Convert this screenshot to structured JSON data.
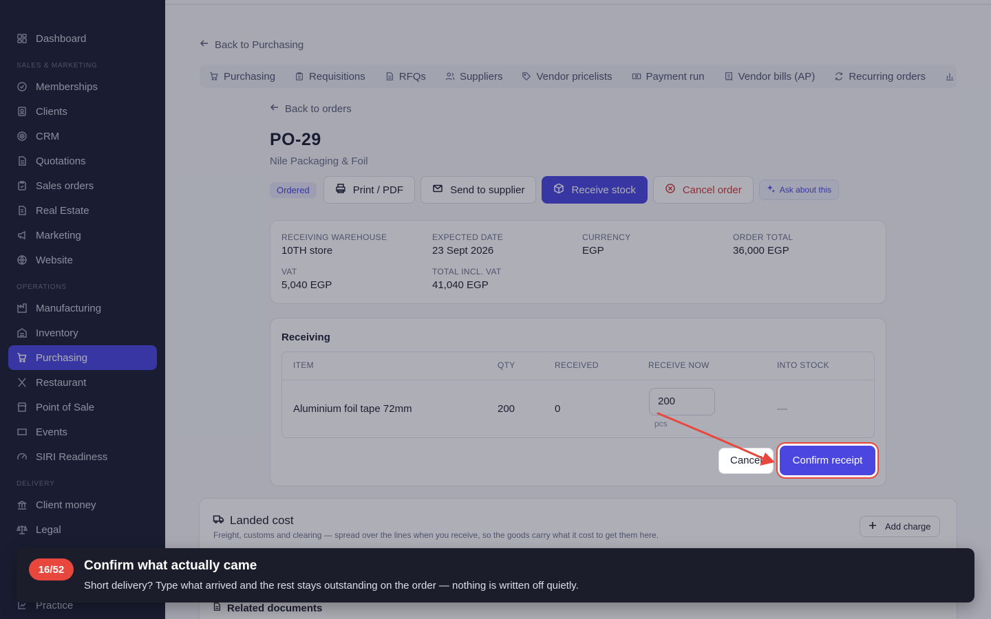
{
  "sidebar": {
    "top": [
      {
        "label": "Dashboard",
        "icon": "dashboard-icon"
      }
    ],
    "sections": [
      {
        "title": "SALES & MARKETING",
        "items": [
          {
            "label": "Memberships",
            "icon": "membership-icon"
          },
          {
            "label": "Clients",
            "icon": "clients-icon"
          },
          {
            "label": "CRM",
            "icon": "crm-icon"
          },
          {
            "label": "Quotations",
            "icon": "quotation-icon"
          },
          {
            "label": "Sales orders",
            "icon": "sales-order-icon"
          },
          {
            "label": "Real Estate",
            "icon": "real-estate-icon"
          },
          {
            "label": "Marketing",
            "icon": "megaphone-icon"
          },
          {
            "label": "Website",
            "icon": "globe-icon"
          }
        ]
      },
      {
        "title": "OPERATIONS",
        "items": [
          {
            "label": "Manufacturing",
            "icon": "factory-icon"
          },
          {
            "label": "Inventory",
            "icon": "warehouse-icon"
          },
          {
            "label": "Purchasing",
            "icon": "cart-icon",
            "active": true
          },
          {
            "label": "Restaurant",
            "icon": "utensils-icon"
          },
          {
            "label": "Point of Sale",
            "icon": "store-icon"
          },
          {
            "label": "Events",
            "icon": "ticket-icon"
          },
          {
            "label": "SIRI Readiness",
            "icon": "gauge-icon"
          }
        ]
      },
      {
        "title": "DELIVERY",
        "items": [
          {
            "label": "Client money",
            "icon": "bank-icon"
          },
          {
            "label": "Legal",
            "icon": "scale-icon"
          }
        ]
      }
    ],
    "bottom": [
      {
        "label": "Practice",
        "icon": "practice-icon"
      }
    ]
  },
  "header": {
    "back_purchasing": "Back to Purchasing",
    "tabs": [
      {
        "label": "Purchasing",
        "icon": "cart-icon"
      },
      {
        "label": "Requisitions",
        "icon": "clipboard-icon"
      },
      {
        "label": "RFQs",
        "icon": "document-icon"
      },
      {
        "label": "Suppliers",
        "icon": "users-icon"
      },
      {
        "label": "Vendor pricelists",
        "icon": "tag-icon"
      },
      {
        "label": "Payment run",
        "icon": "banknote-icon"
      },
      {
        "label": "Vendor bills (AP)",
        "icon": "receipt-icon"
      },
      {
        "label": "Recurring orders",
        "icon": "refresh-icon"
      }
    ]
  },
  "order": {
    "back_orders": "Back to orders",
    "number": "PO-29",
    "supplier": "Nile Packaging & Foil",
    "status": "Ordered",
    "actions": {
      "print": "Print / PDF",
      "send": "Send to supplier",
      "receive": "Receive stock",
      "cancel": "Cancel order",
      "ask": "Ask about this"
    },
    "summary": {
      "warehouse_label": "RECEIVING WAREHOUSE",
      "warehouse": "10TH store",
      "expected_label": "EXPECTED DATE",
      "expected": "23 Sept 2026",
      "currency_label": "CURRENCY",
      "currency": "EGP",
      "total_label": "ORDER TOTAL",
      "total": "36,000 EGP",
      "vat_label": "VAT",
      "vat": "5,040 EGP",
      "incl_label": "TOTAL INCL. VAT",
      "incl": "41,040 EGP"
    }
  },
  "receiving": {
    "title": "Receiving",
    "columns": {
      "item": "ITEM",
      "qty": "QTY",
      "received": "RECEIVED",
      "receive_now": "RECEIVE NOW",
      "into_stock": "INTO STOCK"
    },
    "row": {
      "item": "Aluminium foil tape 72mm",
      "qty": "200",
      "received": "0",
      "receive_now": "200",
      "unit": "pcs",
      "into_stock": "—"
    },
    "cancel": "Cancel",
    "confirm": "Confirm receipt"
  },
  "landed": {
    "title": "Landed cost",
    "desc": "Freight, customs and clearing — spread over the lines when you receive, so the goods carry what it cost to get them here.",
    "add": "Add charge"
  },
  "related": {
    "title": "Related documents"
  },
  "tour": {
    "step": "16/52",
    "title": "Confirm what actually came",
    "text": "Short delivery? Type what arrived and the rest stays outstanding on the order — nothing is written off quietly."
  },
  "colors": {
    "accent": "#4b46e0",
    "highlight": "#e8473d",
    "sidebar": "#1c1f33"
  }
}
